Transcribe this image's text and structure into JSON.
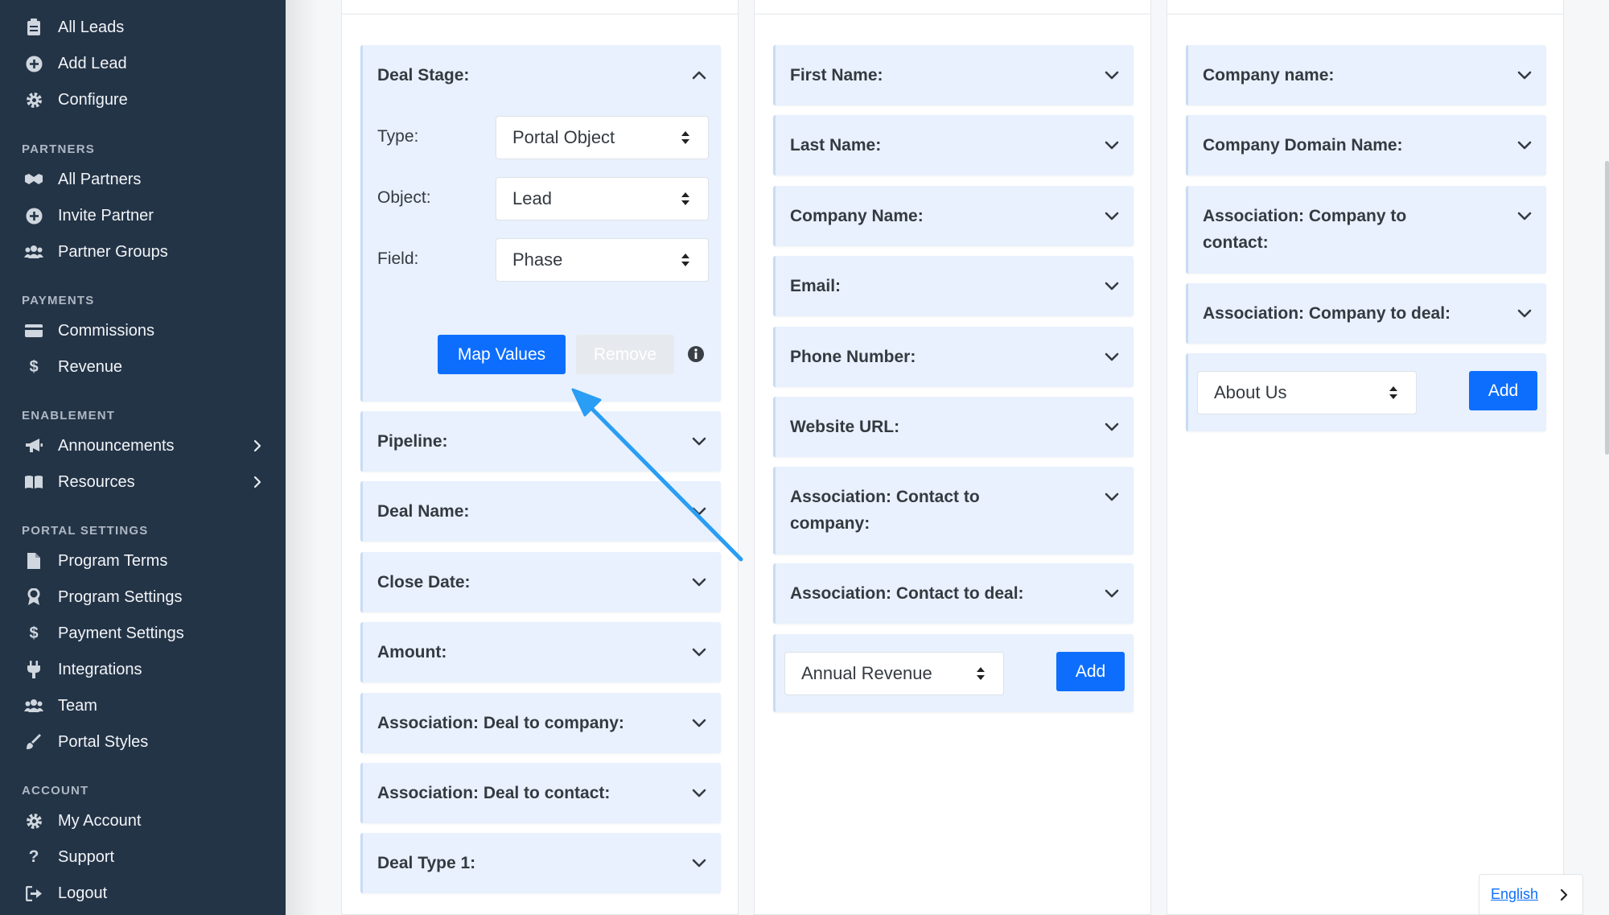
{
  "sidebar": {
    "leads_items": [
      {
        "label": "All Leads",
        "icon": "clipboard-icon"
      },
      {
        "label": "Add Lead",
        "icon": "plus-circle-icon"
      },
      {
        "label": "Configure",
        "icon": "gear-icon"
      }
    ],
    "partners_heading": "PARTNERS",
    "partners_items": [
      {
        "label": "All Partners",
        "icon": "handshake-icon"
      },
      {
        "label": "Invite Partner",
        "icon": "plus-circle-icon"
      },
      {
        "label": "Partner Groups",
        "icon": "users-icon"
      }
    ],
    "payments_heading": "PAYMENTS",
    "payments_items": [
      {
        "label": "Commissions",
        "icon": "credit-card-icon"
      },
      {
        "label": "Revenue",
        "icon": "dollar-icon"
      }
    ],
    "enablement_heading": "ENABLEMENT",
    "enablement_items": [
      {
        "label": "Announcements",
        "icon": "megaphone-icon"
      },
      {
        "label": "Resources",
        "icon": "book-icon"
      }
    ],
    "portal_settings_heading": "PORTAL SETTINGS",
    "portal_settings_items": [
      {
        "label": "Program Terms",
        "icon": "document-icon"
      },
      {
        "label": "Program Settings",
        "icon": "award-icon"
      },
      {
        "label": "Payment Settings",
        "icon": "dollar-icon"
      },
      {
        "label": "Integrations",
        "icon": "plug-icon"
      },
      {
        "label": "Team",
        "icon": "users-icon"
      },
      {
        "label": "Portal Styles",
        "icon": "brush-icon"
      }
    ],
    "account_heading": "ACCOUNT",
    "account_items": [
      {
        "label": "My Account",
        "icon": "gear-icon"
      },
      {
        "label": "Support",
        "icon": "question-icon"
      },
      {
        "label": "Logout",
        "icon": "logout-icon"
      }
    ]
  },
  "deal_column": {
    "expanded_card": {
      "title": "Deal Stage:",
      "type_label": "Type:",
      "type_value": "Portal Object",
      "object_label": "Object:",
      "object_value": "Lead",
      "field_label": "Field:",
      "field_value": "Phase",
      "map_values_label": "Map Values",
      "remove_label": "Remove"
    },
    "cards": [
      "Pipeline:",
      "Deal Name:",
      "Close Date:",
      "Amount:",
      "Association: Deal to company:",
      "Association: Deal to contact:",
      "Deal Type 1:"
    ]
  },
  "contact_column": {
    "cards": [
      "First Name:",
      "Last Name:",
      "Company Name:",
      "Email:",
      "Phone Number:",
      "Website URL:"
    ],
    "assoc_company": [
      "Association: Contact to",
      "company:"
    ],
    "assoc_deal": "Association: Contact to deal:",
    "add_select_value": "Annual Revenue",
    "add_label": "Add"
  },
  "company_column": {
    "cards": [
      "Company name:",
      "Company Domain Name:"
    ],
    "assoc_contact": [
      "Association: Company to",
      "contact:"
    ],
    "assoc_deal": "Association: Company to deal:",
    "add_select_value": "About Us",
    "add_label": "Add"
  },
  "language": {
    "label": "English"
  },
  "colors": {
    "sidebar": "#243447",
    "primary": "#0d6efd",
    "card": "#e8f1fd",
    "annotation_arrow": "#2a9df4"
  }
}
